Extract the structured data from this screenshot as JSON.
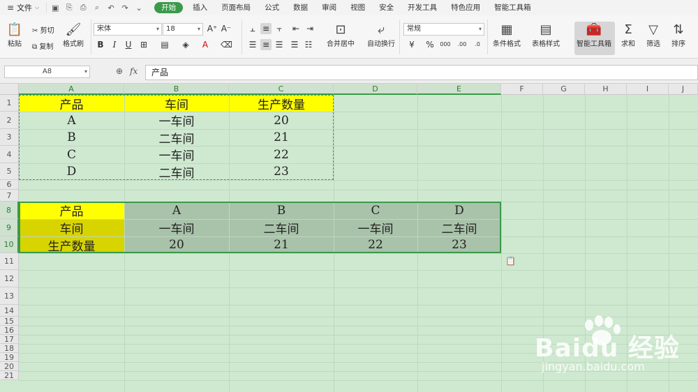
{
  "menubar": {
    "file_label": "文件",
    "tabs": [
      "开始",
      "插入",
      "页面布局",
      "公式",
      "数据",
      "审阅",
      "视图",
      "安全",
      "开发工具",
      "特色应用",
      "智能工具箱"
    ],
    "active_tab": "开始"
  },
  "ribbon": {
    "paste": "粘贴",
    "cut": "剪切",
    "copy": "复制",
    "format_painter": "格式刷",
    "font_name": "宋体",
    "font_size": "18",
    "merge_center": "合并居中",
    "wrap_text": "自动换行",
    "number_format": "常规",
    "conditional_format": "条件格式",
    "table_style": "表格样式",
    "smart_toolbox": "智能工具箱",
    "sum": "求和",
    "filter": "筛选",
    "sort": "排序"
  },
  "formula_bar": {
    "name_box": "A8",
    "fx_label": "fx",
    "content": "产品"
  },
  "columns": [
    "A",
    "B",
    "C",
    "D",
    "E",
    "F",
    "G",
    "H",
    "I",
    "J"
  ],
  "rows": [
    "1",
    "2",
    "3",
    "4",
    "5",
    "6",
    "7",
    "8",
    "9",
    "10",
    "11",
    "12",
    "13",
    "14",
    "15",
    "16",
    "17",
    "18",
    "19",
    "20",
    "21"
  ],
  "source_table": {
    "headers": [
      "产品",
      "车间",
      "生产数量"
    ],
    "rows": [
      [
        "A",
        "一车间",
        "20"
      ],
      [
        "B",
        "二车间",
        "21"
      ],
      [
        "C",
        "一车间",
        "22"
      ],
      [
        "D",
        "二车间",
        "23"
      ]
    ]
  },
  "transposed_table": {
    "row_labels": [
      "产品",
      "车间",
      "生产数量"
    ],
    "rows": [
      [
        "A",
        "B",
        "C",
        "D"
      ],
      [
        "一车间",
        "二车间",
        "一车间",
        "二车间"
      ],
      [
        "20",
        "21",
        "22",
        "23"
      ]
    ]
  },
  "watermark": {
    "logo": "Baidu 经验",
    "url": "jingyan.baidu.com"
  },
  "colors": {
    "accent_green": "#3a9a4a",
    "sheet_bg": "#cfe8d0",
    "header_yellow": "#ffff00",
    "selected_olive": "#d8d400",
    "selected_gray": "#a9c2aa"
  }
}
